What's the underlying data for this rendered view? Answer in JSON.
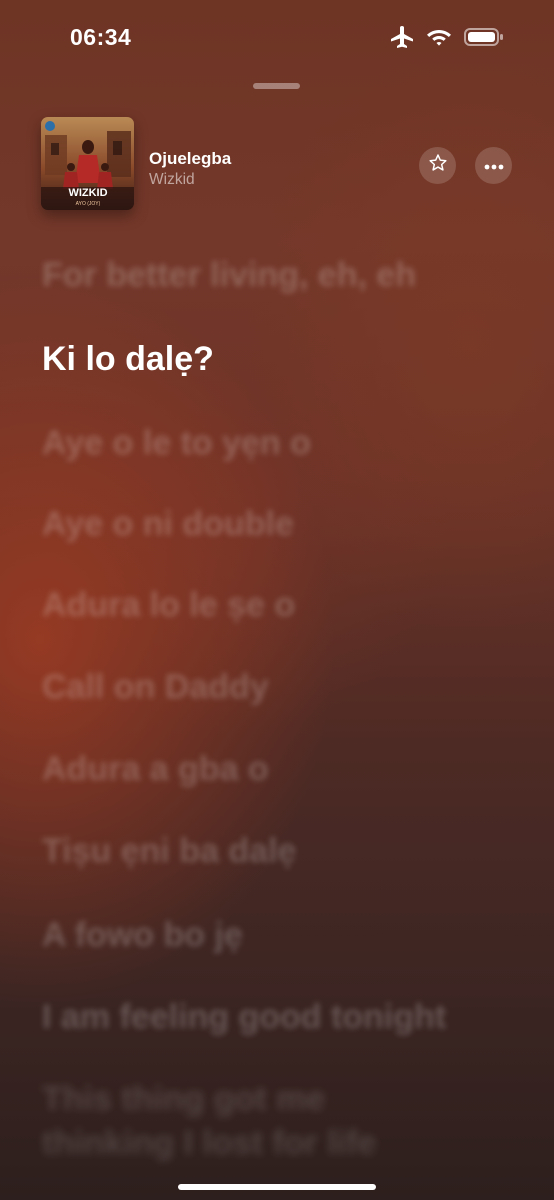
{
  "status_bar": {
    "time": "06:34",
    "icons": [
      "airplane-icon",
      "wifi-icon",
      "battery-icon"
    ]
  },
  "now_playing": {
    "title": "Ojuelegba",
    "artist": "Wizkid",
    "album_art": {
      "text_main": "WIZKID",
      "text_sub": "AYO (JOY)"
    }
  },
  "actions": {
    "favorite_icon": "star-icon",
    "more_icon": "ellipsis-icon"
  },
  "lyrics": {
    "lines": [
      "For better living, eh, eh",
      "Ki lo dalẹ?",
      "Aye o le to yẹn o",
      "Aye o ni double",
      "Adura lo le ṣe o",
      "Call on Daddy",
      "Adura a gba o",
      "Tiṣu ẹni ba dalẹ",
      "A fowo bo jẹ",
      "I am feeling good tonight",
      "This thing got me",
      "thinking I lost for life"
    ],
    "active_index": 1
  },
  "colors": {
    "background_top": "#6e3424",
    "background_bottom": "#2d1f1d",
    "accent_warm": "#a03c23"
  }
}
